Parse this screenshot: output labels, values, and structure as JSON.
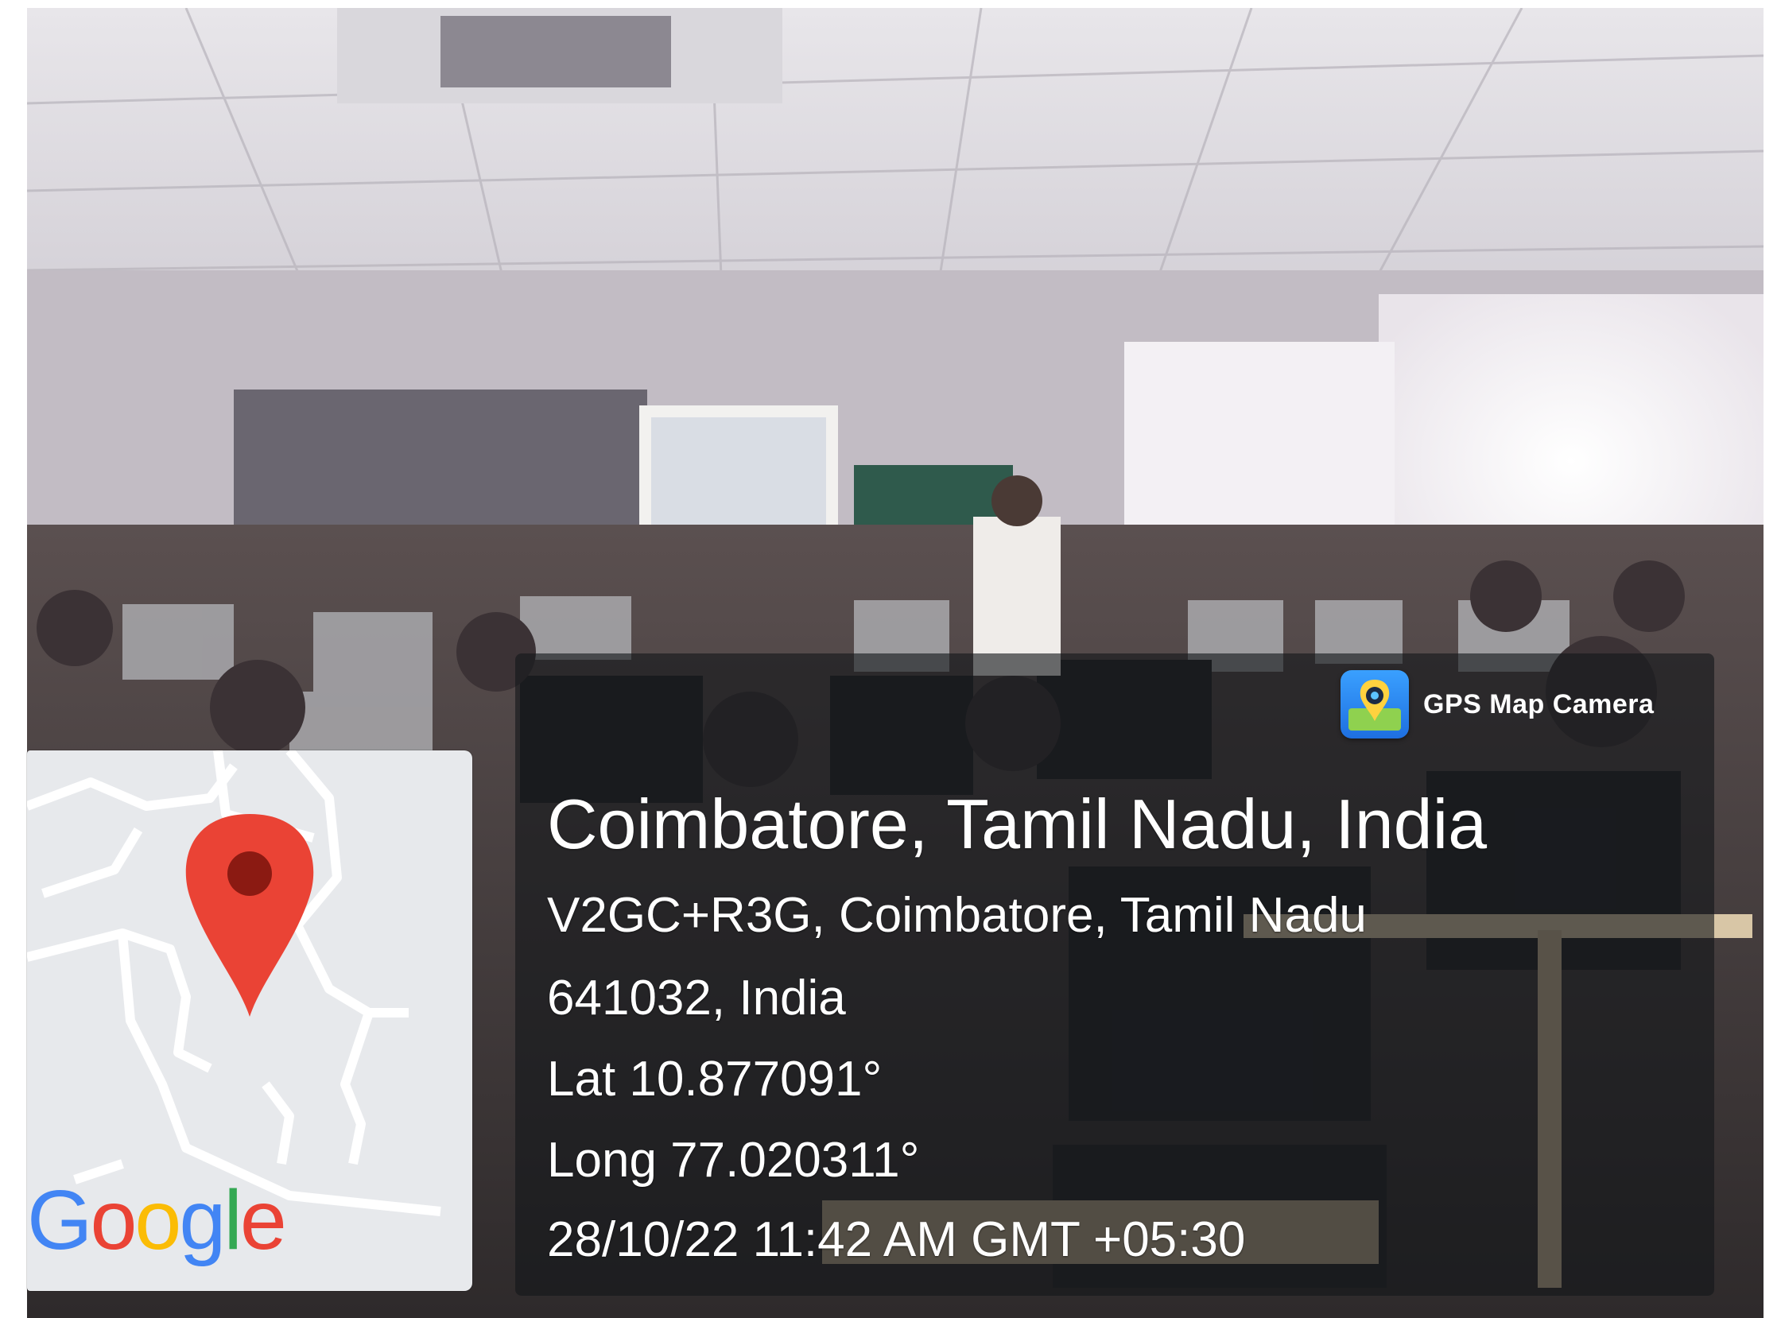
{
  "overlay": {
    "app_name": "GPS Map Camera",
    "location_title": "Coimbatore, Tamil Nadu, India",
    "address_line1": "V2GC+R3G, Coimbatore, Tamil Nadu",
    "address_line2": "641032, India",
    "latitude": "Lat 10.877091°",
    "longitude": "Long 77.020311°",
    "datetime": "28/10/22 11:42 AM GMT +05:30"
  },
  "map": {
    "logo_letters": [
      "G",
      "o",
      "o",
      "g",
      "l",
      "e"
    ],
    "pin_color": "#ea4335",
    "pin_center_color": "#8b1a12"
  },
  "photo": {
    "description_icon": "classroom-photo"
  }
}
